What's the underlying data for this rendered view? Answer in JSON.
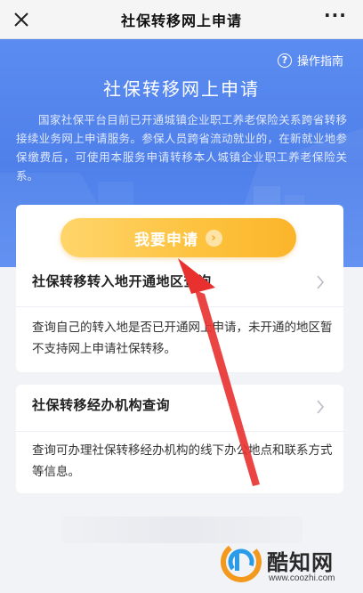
{
  "nav": {
    "title": "社保转移网上申请",
    "close_icon": "close-icon",
    "more_label": "···"
  },
  "hero": {
    "guide_icon_label": "?",
    "guide_label": "操作指南",
    "title": "社保转移网上申请",
    "description": "国家社保平台目前已开通城镇企业职工养老保险关系跨省转移接续业务网上申请服务。参保人员跨省流动就业的，在新就业地参保缴费后，可使用本服务申请转移本人城镇企业职工养老保险关系。"
  },
  "apply": {
    "label": "我要申请",
    "arrow_label": "›"
  },
  "sections": [
    {
      "title": "社保转移转入地开通地区查询",
      "text": "查询自己的转入地是否已开通网上申请，未开通的地区暂不支持网上申请社保转移。"
    },
    {
      "title": "社保转移经办机构查询",
      "text": "查询可办理社保转移经办机构的线下办公地点和联系方式等信息。"
    }
  ],
  "watermark": {
    "name": "酷知网",
    "url": "www.coozhi.com"
  },
  "colors": {
    "hero_blue": "#5287ee",
    "button_yellow": "#fdc23e",
    "arrow_red": "#e8312f"
  }
}
